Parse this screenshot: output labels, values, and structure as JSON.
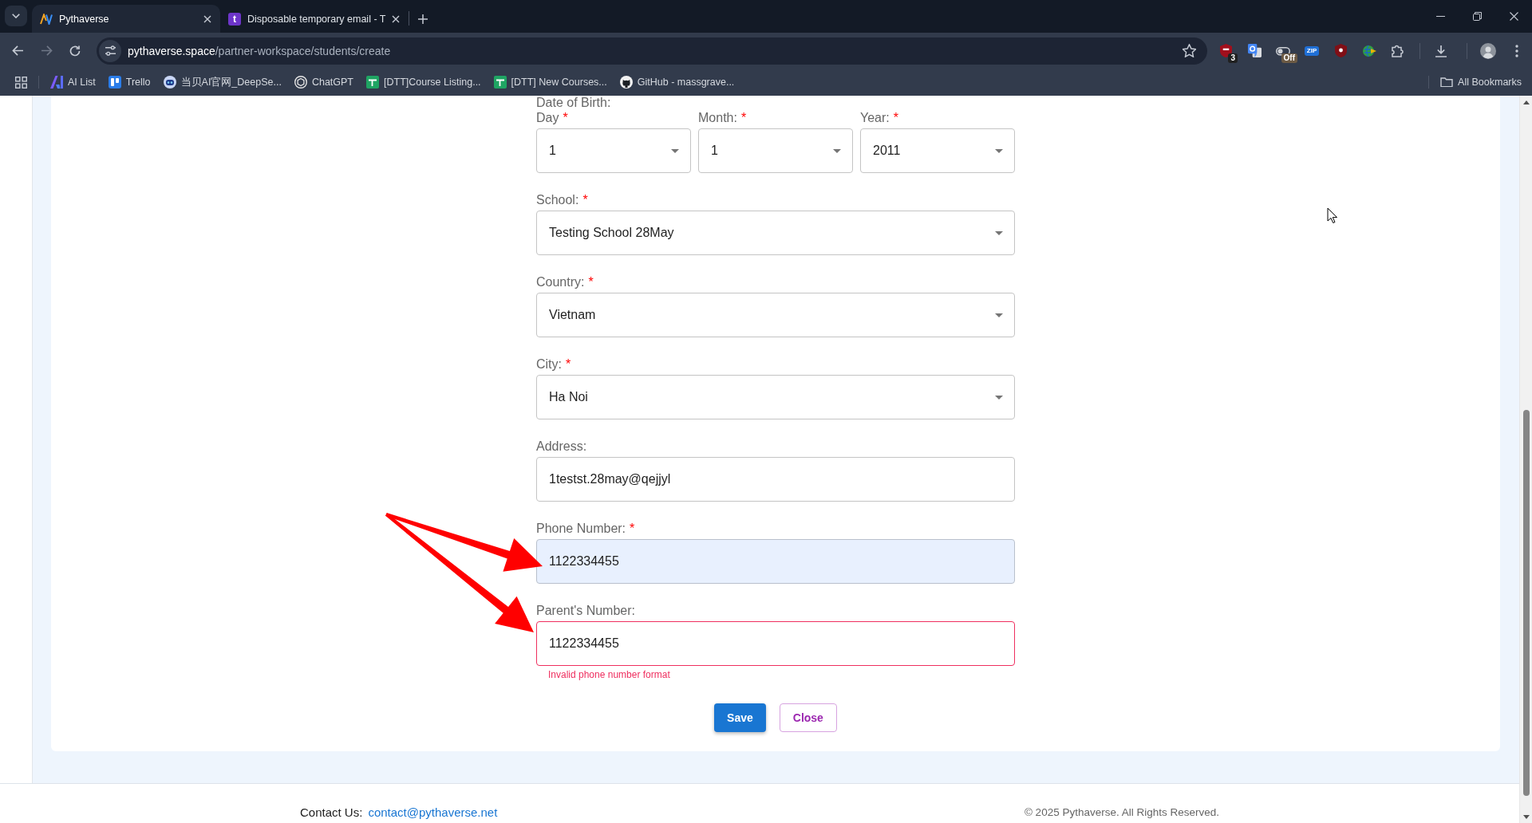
{
  "browser": {
    "tabs": [
      {
        "title": "Pythaverse",
        "selected": true,
        "kind": "logo"
      },
      {
        "title": "Disposable temporary email - T",
        "selected": false,
        "kind": "letter",
        "icon_text": "t"
      }
    ],
    "address": {
      "host": "pythaverse.space",
      "path": "/partner-workspace/students/create"
    },
    "extensions": [
      {
        "kind": "shield",
        "badge": "3"
      },
      {
        "kind": "translate"
      },
      {
        "kind": "toggle",
        "badge": "Off"
      },
      {
        "kind": "zip",
        "label": "ZIP"
      },
      {
        "kind": "shield-dark"
      },
      {
        "kind": "globe"
      }
    ],
    "bookmarks": [
      {
        "label": "AI List",
        "kind": "ai"
      },
      {
        "label": "Trello",
        "kind": "board"
      },
      {
        "label": "当贝AI官网_DeepSe...",
        "kind": "robot"
      },
      {
        "label": "ChatGPT",
        "kind": "knot"
      },
      {
        "label": "[DTT]Course Listing...",
        "kind": "sheet"
      },
      {
        "label": "[DTT] New Courses...",
        "kind": "sheet"
      },
      {
        "label": "GitHub - massgrave...",
        "kind": "cat"
      }
    ],
    "all_bookmarks": "All Bookmarks"
  },
  "form": {
    "section_label": "Date of Birth:",
    "date_fields": [
      {
        "label": "Day",
        "required_mark": "*",
        "value": "1"
      },
      {
        "label": "Month:",
        "required_mark": "*",
        "value": "1"
      },
      {
        "label": "Year:",
        "required_mark": "*",
        "value": "2011"
      }
    ],
    "fields": [
      {
        "kind": "select",
        "label": "School:",
        "required_mark": "*",
        "value": "Testing School 28May",
        "autofilled": false,
        "invalid": false,
        "arrow": false
      },
      {
        "kind": "select",
        "label": "Country:",
        "required_mark": "*",
        "value": "Vietnam",
        "autofilled": false,
        "invalid": false,
        "arrow": false
      },
      {
        "kind": "select",
        "label": "City:",
        "required_mark": "*",
        "value": "Ha Noi",
        "autofilled": false,
        "invalid": false,
        "arrow": false
      },
      {
        "kind": "text",
        "label": "Address:",
        "value": "1testst.28may@qejjyl",
        "autofilled": false,
        "invalid": false,
        "arrow": false
      },
      {
        "kind": "text",
        "label": "Phone Number:",
        "required_mark": "*",
        "value": "1122334455",
        "autofilled": true,
        "invalid": false,
        "arrow": true
      },
      {
        "kind": "text",
        "label": "Parent's Number:",
        "value": "1122334455",
        "autofilled": false,
        "invalid": true,
        "error": "Invalid phone number format",
        "arrow": true
      }
    ],
    "buttons": [
      {
        "kind": "contained",
        "label": "Save"
      },
      {
        "kind": "outlined",
        "label": "Close"
      }
    ]
  },
  "footer": {
    "contact_label": "Contact Us:",
    "contact_email": "contact@pythaverse.net",
    "copyright": "© 2025 Pythaverse. All Rights Reserved."
  }
}
